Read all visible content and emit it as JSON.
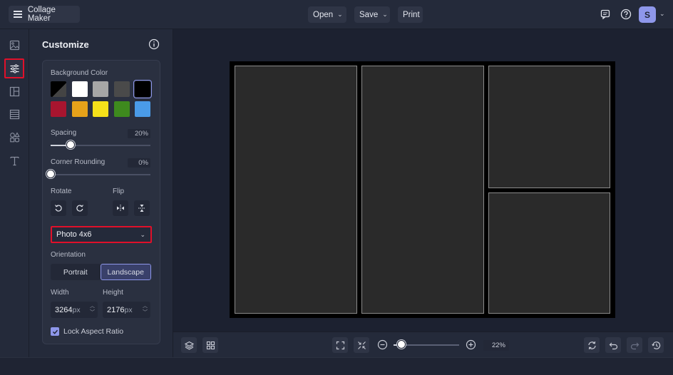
{
  "app": {
    "title": "Collage Maker"
  },
  "toolbar": {
    "open_label": "Open",
    "save_label": "Save",
    "print_label": "Print",
    "avatar_initial": "S"
  },
  "panel": {
    "title": "Customize",
    "background_color_label": "Background Color",
    "swatches": [
      "#000000",
      "#ffffff",
      "#a6a6a6",
      "#4a4a4a",
      "#000000",
      "#a8152f",
      "#e6a21a",
      "#f5e11a",
      "#3e8a1e",
      "#4a9be8"
    ],
    "spacing_label": "Spacing",
    "spacing_value": "20%",
    "spacing_fraction": 0.2,
    "corner_label": "Corner Rounding",
    "corner_value": "0%",
    "corner_fraction": 0,
    "rotate_label": "Rotate",
    "flip_label": "Flip",
    "size_preset": "Photo 4x6",
    "orientation_label": "Orientation",
    "portrait_label": "Portrait",
    "landscape_label": "Landscape",
    "width_label": "Width",
    "height_label": "Height",
    "width_value": "3264",
    "height_value": "2176",
    "unit": "px",
    "lock_label": "Lock Aspect Ratio"
  },
  "zoom": {
    "value": "22%",
    "fraction": 0.12
  }
}
